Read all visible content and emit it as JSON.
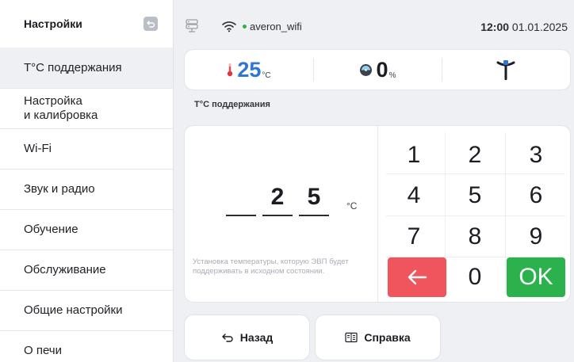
{
  "sidebar": {
    "title": "Настройки",
    "items": [
      {
        "label": "T°С поддержания",
        "active": true
      },
      {
        "label": "Настройка\nи калибровка",
        "active": false
      },
      {
        "label": "Wi-Fi",
        "active": false
      },
      {
        "label": "Звук и радио",
        "active": false
      },
      {
        "label": "Обучение",
        "active": false
      },
      {
        "label": "Обслуживание",
        "active": false
      },
      {
        "label": "Общие настройки",
        "active": false
      },
      {
        "label": "О печи",
        "active": false
      }
    ]
  },
  "topbar": {
    "wifi_name": "averon_wifi",
    "time": "12:00",
    "date": "01.01.2025",
    "wifi_status_color": "#2db24a"
  },
  "status": {
    "temperature": "25",
    "temperature_unit": "°C",
    "humidity": "0",
    "humidity_unit": "%",
    "icons": [
      "thermometer-icon",
      "humidity-gauge-icon",
      "probe-icon"
    ]
  },
  "section_label": "T°С поддержания",
  "entry": {
    "digits": [
      "",
      "2",
      "5"
    ],
    "unit": "°C",
    "hint": "Установка температуры, которую ЭВП будет поддерживать в исходном состоянии."
  },
  "keypad": {
    "keys": [
      "1",
      "2",
      "3",
      "4",
      "5",
      "6",
      "7",
      "8",
      "9",
      "←",
      "0",
      "OK"
    ],
    "back_color": "#f0555d",
    "ok_color": "#2bb24c"
  },
  "buttons": {
    "back_label": "Назад",
    "help_label": "Справка"
  }
}
